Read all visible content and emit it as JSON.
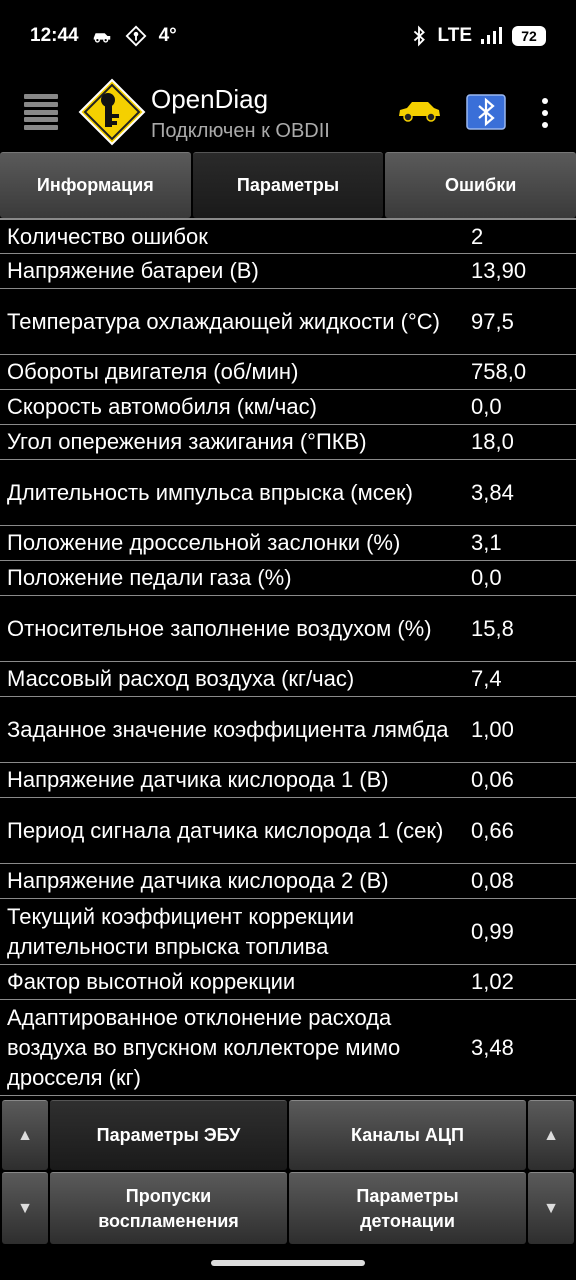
{
  "status_bar": {
    "time": "12:44",
    "temperature": "4°",
    "network": "LTE",
    "battery": "72",
    "icons": [
      "car-notification-icon",
      "location-icon",
      "bluetooth-icon",
      "signal-icon"
    ]
  },
  "app_bar": {
    "title": "OpenDiag",
    "subtitle": "Подключен к OBDII",
    "icons": [
      "menu-icon",
      "app-logo",
      "car-icon",
      "bluetooth-elm-icon",
      "more-icon"
    ]
  },
  "tabs": [
    {
      "label": "Информация",
      "active": false
    },
    {
      "label": "Параметры",
      "active": true
    },
    {
      "label": "Ошибки",
      "active": false
    }
  ],
  "parameters": [
    {
      "name": "Количество ошибок",
      "value": "2"
    },
    {
      "name": "Напряжение батареи (В)",
      "value": "13,90"
    },
    {
      "name": "Температура охлаждающей жидкости (°С)",
      "value": "97,5"
    },
    {
      "name": "Обороты двигателя (об/мин)",
      "value": "758,0"
    },
    {
      "name": "Скорость автомобиля (км/час)",
      "value": "0,0"
    },
    {
      "name": "Угол опережения зажигания (°ПКВ)",
      "value": "18,0"
    },
    {
      "name": "Длительность импульса впрыска (мсек)",
      "value": "3,84"
    },
    {
      "name": "Положение дроссельной заслонки (%)",
      "value": "3,1"
    },
    {
      "name": "Положение педали газа (%)",
      "value": "0,0"
    },
    {
      "name": "Относительное заполнение воздухом (%)",
      "value": "15,8"
    },
    {
      "name": "Массовый расход воздуха (кг/час)",
      "value": "7,4"
    },
    {
      "name": "Заданное значение коэффициента лямбда",
      "value": "1,00"
    },
    {
      "name": "Напряжение датчика кислорода 1 (В)",
      "value": "0,06"
    },
    {
      "name": "Период сигнала датчика кислорода 1 (сек)",
      "value": "0,66"
    },
    {
      "name": "Напряжение датчика кислорода 2 (В)",
      "value": "0,08"
    },
    {
      "name": "Текущий коэффициент коррекции длительности впрыска топлива",
      "value": "0,99"
    },
    {
      "name": "Фактор высотной коррекции",
      "value": "1,02"
    },
    {
      "name": "Адаптированное отклонение расхода воздуха во впускном коллекторе мимо дросселя (кг)",
      "value": "3,48"
    }
  ],
  "bottom_buttons": {
    "ecu_params": "Параметры ЭБУ",
    "adc_channels": "Каналы АЦП",
    "misfires": "Пропуски воспламенения",
    "knock_params": "Параметры детонации",
    "up_arrow": "▲",
    "down_arrow": "▼"
  },
  "colors": {
    "background": "#000000",
    "tab_gradient_top": "#5a5a5a",
    "tab_gradient_bottom": "#3a3a3a",
    "logo_yellow": "#f5d000",
    "divider": "#8a8a8a"
  }
}
